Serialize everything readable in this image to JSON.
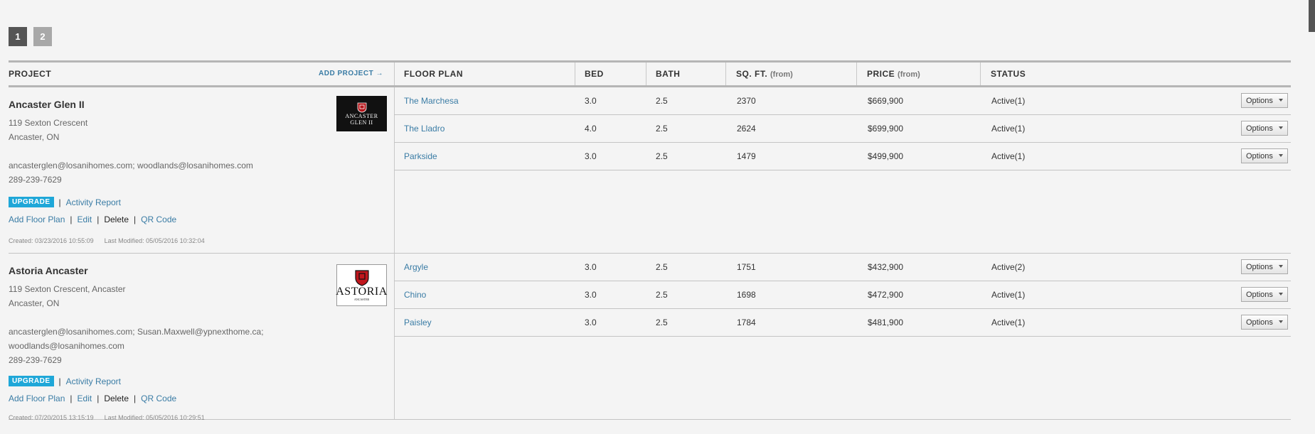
{
  "pagination": {
    "pages": [
      "1",
      "2"
    ],
    "current": "1"
  },
  "header": {
    "project": "PROJECT",
    "add_project": "ADD PROJECT →",
    "floor_plan": "FLOOR PLAN",
    "bed": "BED",
    "bath": "BATH",
    "sqft": "SQ. FT.",
    "sqft_sub": "(from)",
    "price": "PRICE",
    "price_sub": "(from)",
    "status": "STATUS"
  },
  "projects": [
    {
      "name": "Ancaster Glen II",
      "address1": "119 Sexton Crescent",
      "address2": "Ancaster, ON",
      "emails": "ancasterglen@losanihomes.com; woodlands@losanihomes.com",
      "emails2": "",
      "phone": "289-239-7629",
      "logo": {
        "line1": "ANCASTER",
        "line2": "GLEN II",
        "line3": ""
      },
      "upgrade": "UPGRADE",
      "activity": "Activity Report",
      "add_floor_plan": "Add Floor Plan",
      "edit": "Edit",
      "delete": "Delete",
      "qr": "QR Code",
      "created": "Created: 03/23/2016 10:55:09",
      "modified": "Last Modified: 05/05/2016 10:32:04",
      "plans": [
        {
          "name": "The Marchesa",
          "bed": "3.0",
          "bath": "2.5",
          "sqft": "2370",
          "price": "$669,900",
          "status": "Active(1)",
          "options": "Options"
        },
        {
          "name": "The Lladro",
          "bed": "4.0",
          "bath": "2.5",
          "sqft": "2624",
          "price": "$699,900",
          "status": "Active(1)",
          "options": "Options"
        },
        {
          "name": "Parkside",
          "bed": "3.0",
          "bath": "2.5",
          "sqft": "1479",
          "price": "$499,900",
          "status": "Active(1)",
          "options": "Options"
        }
      ]
    },
    {
      "name": "Astoria Ancaster",
      "address1": "119 Sexton Crescent, Ancaster",
      "address2": "Ancaster, ON",
      "emails": "ancasterglen@losanihomes.com; Susan.Maxwell@ypnexthome.ca;",
      "emails2": "woodlands@losanihomes.com",
      "phone": "289-239-7629",
      "logo": {
        "line1": "ASTORIA",
        "line2": "ANCASTER",
        "line3": ""
      },
      "upgrade": "UPGRADE",
      "activity": "Activity Report",
      "add_floor_plan": "Add Floor Plan",
      "edit": "Edit",
      "delete": "Delete",
      "qr": "QR Code",
      "created": "Created: 07/20/2015 13:15:19",
      "modified": "Last Modified: 05/05/2016 10:29:51",
      "plans": [
        {
          "name": "Argyle",
          "bed": "3.0",
          "bath": "2.5",
          "sqft": "1751",
          "price": "$432,900",
          "status": "Active(2)",
          "options": "Options"
        },
        {
          "name": "Chino",
          "bed": "3.0",
          "bath": "2.5",
          "sqft": "1698",
          "price": "$472,900",
          "status": "Active(1)",
          "options": "Options"
        },
        {
          "name": "Paisley",
          "bed": "3.0",
          "bath": "2.5",
          "sqft": "1784",
          "price": "$481,900",
          "status": "Active(1)",
          "options": "Options"
        }
      ]
    }
  ],
  "colors": {
    "link": "#3a7ca5",
    "upgrade": "#1fa7d8",
    "background": "#f4f4f4"
  }
}
